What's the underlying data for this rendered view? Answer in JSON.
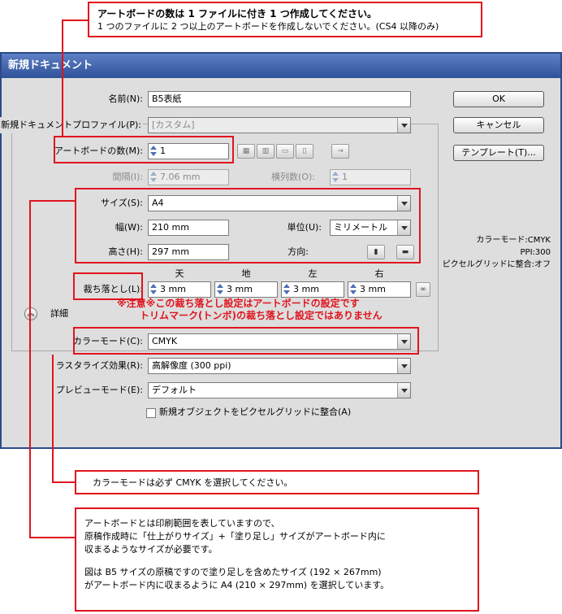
{
  "notes": {
    "top_title": "アートボードの数は 1 ファイルに付き 1 つ作成してください。",
    "top_body": "1 つのファイルに 2 つ以上のアートボードを作成しないでください。(CS4 以降のみ)",
    "bleed_warn_1": "※注意※この裁ち落とし設定はアートボードの設定です",
    "bleed_warn_2": "トリムマーク(トンボ)の裁ち落とし設定ではありません",
    "color_mode": "カラーモードは必ず CMYK を選択してください。",
    "artboard_1": "アートボードとは印刷範囲を表していますので、",
    "artboard_2": "原稿作成時に「仕上がりサイズ」+「塗り足し」サイズがアートボード内に",
    "artboard_3": "収まるようなサイズが必要です。",
    "artboard_4": "図は B5 サイズの原稿ですので塗り足しを含めたサイズ (192 × 267mm)",
    "artboard_5": "がアートボード内に収まるように A4 (210 × 297mm) を選択しています。"
  },
  "dialog": {
    "title": "新規ドキュメント",
    "name_label": "名前(N):",
    "name_value": "B5表紙",
    "profile_label": "新規ドキュメントプロファイル(P):",
    "profile_value": "[カスタム]",
    "artboards_label": "アートボードの数(M):",
    "artboards_value": "1",
    "spacing_label": "間隔(I):",
    "spacing_value": "7.06 mm",
    "columns_label": "横列数(O):",
    "columns_value": "1",
    "arrange_icons": [
      "grid-by-row-icon",
      "grid-by-column-icon",
      "arrange-row-icon",
      "arrange-column-icon",
      "arrow-right-icon"
    ],
    "size_label": "サイズ(S):",
    "size_value": "A4",
    "width_label": "幅(W):",
    "width_value": "210 mm",
    "units_label": "単位(U):",
    "units_value": "ミリメートル",
    "height_label": "高さ(H):",
    "height_value": "297 mm",
    "orientation_label": "方向:",
    "bleed_label": "裁ち落とし(L):",
    "bleed_headers": [
      "天",
      "地",
      "左",
      "右"
    ],
    "bleed_values": [
      "3 mm",
      "3 mm",
      "3 mm",
      "3 mm"
    ],
    "advanced_label": "詳細",
    "colormode_label": "カラーモード(C):",
    "colormode_value": "CMYK",
    "raster_label": "ラスタライズ効果(R):",
    "raster_value": "高解像度 (300 ppi)",
    "preview_label": "プレビューモード(E):",
    "preview_value": "デフォルト",
    "align_pixel_label": "新規オブジェクトをピクセルグリッドに整合(A)",
    "align_pixel_checked": false,
    "ok_label": "OK",
    "cancel_label": "キャンセル",
    "template_label": "テンプレート(T)...",
    "info_colormode": "カラーモード:CMYK",
    "info_ppi": "PPI:300",
    "info_pixelgrid": "ピクセルグリッドに整合:オフ"
  },
  "colors": {
    "annotation_red": "#e0141e",
    "titlebar": "#2f5199",
    "dialog_bg": "#dedede"
  }
}
